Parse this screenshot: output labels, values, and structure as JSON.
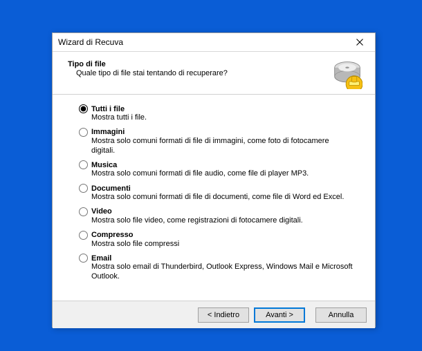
{
  "window": {
    "title": "Wizard di Recuva"
  },
  "header": {
    "heading": "Tipo di file",
    "subheading": "Quale tipo di file stai tentando di recuperare?"
  },
  "options": [
    {
      "label": "Tutti i file",
      "desc": "Mostra tutti i file.",
      "selected": true
    },
    {
      "label": "Immagini",
      "desc": "Mostra solo comuni formati di file di immagini, come foto di fotocamere digitali.",
      "selected": false
    },
    {
      "label": "Musica",
      "desc": "Mostra solo comuni formati di file audio, come file di player MP3.",
      "selected": false
    },
    {
      "label": "Documenti",
      "desc": "Mostra solo comuni formati di file di documenti, come file di Word ed Excel.",
      "selected": false
    },
    {
      "label": "Video",
      "desc": "Mostra solo file video, come registrazioni di fotocamere digitali.",
      "selected": false
    },
    {
      "label": "Compresso",
      "desc": "Mostra solo file compressi",
      "selected": false
    },
    {
      "label": "Email",
      "desc": "Mostra solo email di Thunderbird, Outlook Express, Windows Mail e Microsoft Outlook.",
      "selected": false
    }
  ],
  "buttons": {
    "back": "< Indietro",
    "next": "Avanti >",
    "cancel": "Annulla"
  }
}
